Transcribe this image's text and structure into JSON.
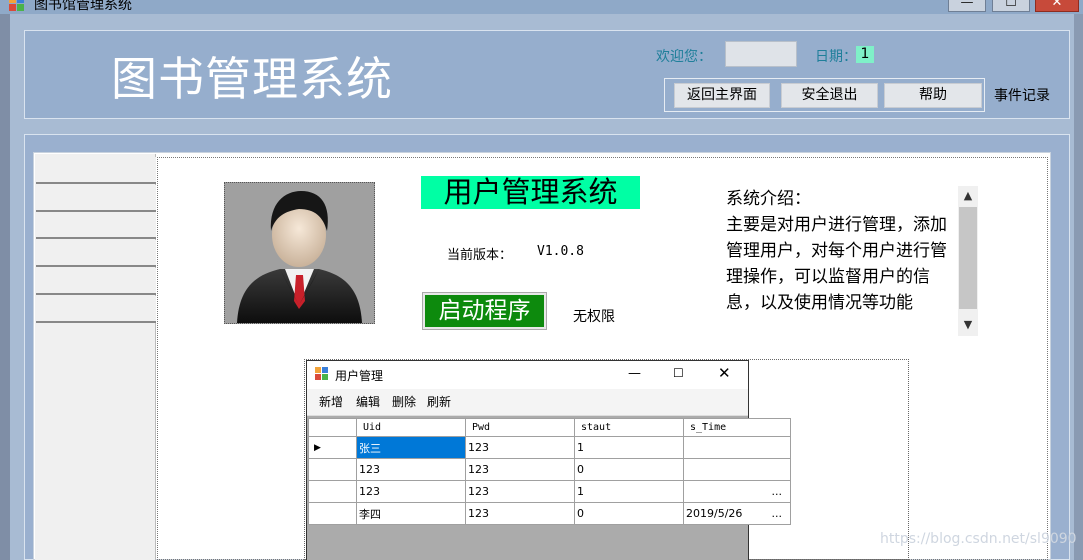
{
  "window": {
    "title": "图书馆管理系统",
    "minimize": "—",
    "maximize": "☐",
    "close": "✕"
  },
  "header": {
    "title": "图书管理系统",
    "welcome_label": "欢迎您：",
    "date_label": "日期：",
    "date_value": "1",
    "buttons": {
      "return": "返回主界面",
      "exit": "安全退出",
      "help": "帮助"
    },
    "event_log": "事件记录"
  },
  "nav": {
    "items": 6
  },
  "user_panel": {
    "title": "用户管理系统",
    "version_label": "当前版本：",
    "version_value": "V1.0.8",
    "start_button": "启动程序",
    "permission": "无权限"
  },
  "intro": {
    "text": "系统介绍：\n主要是对用户进行管理，添加管理用户，对每个用户进行管理操作，可以监督用户的信息，以及使用情况等功能"
  },
  "child_window": {
    "title": "用户管理",
    "toolbar": {
      "new": "新增",
      "edit": "编辑",
      "delete": "删除",
      "refresh": "刷新"
    },
    "columns": [
      "Uid",
      "Pwd",
      "staut",
      "s_Time"
    ],
    "rows": [
      {
        "uid": "张三",
        "pwd": "123",
        "staut": "1",
        "time": "",
        "ellipsis": ""
      },
      {
        "uid": "123",
        "pwd": "123",
        "staut": "0",
        "time": "",
        "ellipsis": ""
      },
      {
        "uid": "123",
        "pwd": "123",
        "staut": "1",
        "time": "",
        "ellipsis": "..."
      },
      {
        "uid": "李四",
        "pwd": "123",
        "staut": "0",
        "time": "2019/5/26",
        "ellipsis": "..."
      }
    ]
  },
  "watermark": "https://blog.csdn.net/sl9090"
}
